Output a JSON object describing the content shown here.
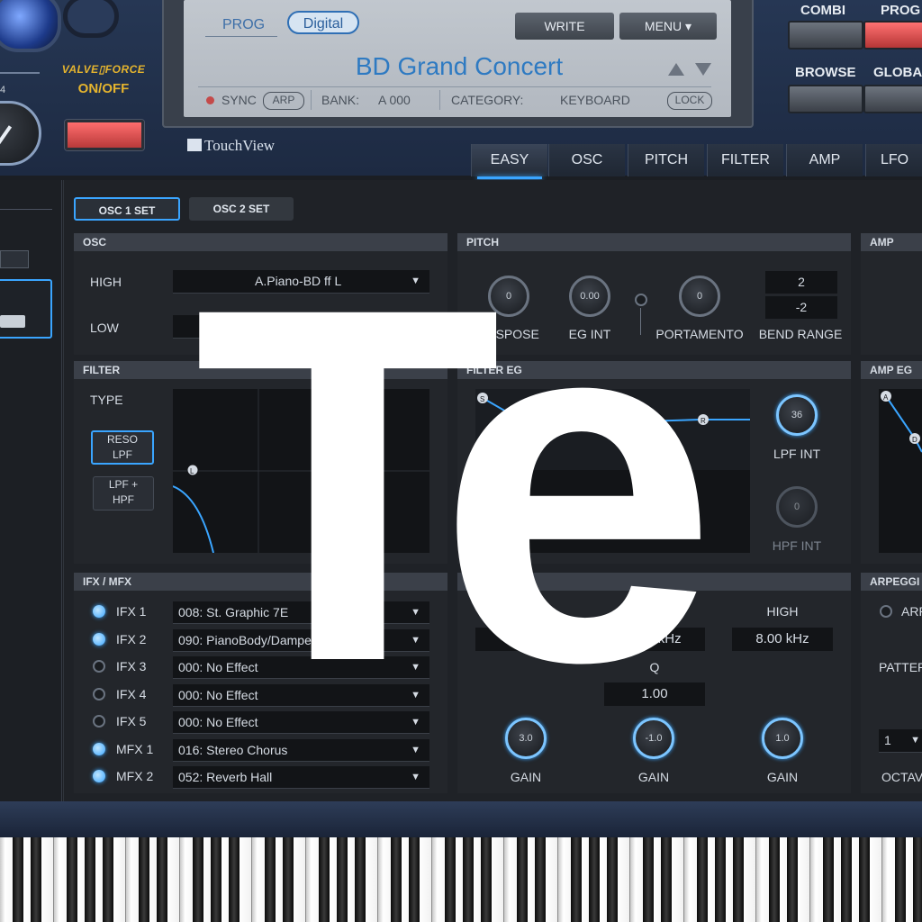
{
  "overlay_text": "Te",
  "left_panel": {
    "valve_force": "VALVE▯FORCE",
    "on_off": "ON/OFF",
    "knob_value": "4",
    "touchview": "TouchView"
  },
  "display": {
    "prog_label": "PROG",
    "mode_pill": "Digital",
    "write_button": "WRITE",
    "menu_button": "MENU ▾",
    "program_name": "BD Grand Concert",
    "sync_label": "SYNC",
    "arp_label": "ARP",
    "bank_label": "BANK:",
    "bank_value": "A 000",
    "category_label": "CATEGORY:",
    "category_value": "KEYBOARD",
    "lock_label": "LOCK"
  },
  "mode_buttons": {
    "combi": "COMBI",
    "prog": "PROG",
    "browse": "BROWSE",
    "global": "GLOBA"
  },
  "tabs": [
    "EASY",
    "OSC",
    "PITCH",
    "FILTER",
    "AMP",
    "LFO"
  ],
  "active_tab": "EASY",
  "osc_tabs": [
    "OSC 1 SET",
    "OSC 2 SET"
  ],
  "osc": {
    "header": "OSC",
    "high_label": "HIGH",
    "high_value": "A.Piano-BD ff L",
    "low_label": "LOW"
  },
  "pitch": {
    "header": "PITCH",
    "transpose_value": "0",
    "transpose_label": "ANSPOSE",
    "eg_int_value": "0.00",
    "eg_int_label": "EG INT",
    "portamento_value": "0",
    "portamento_label": "PORTAMENTO",
    "bend_up": "2",
    "bend_down": "-2",
    "bend_label": "BEND RANGE"
  },
  "amp": {
    "header": "AMP"
  },
  "filter": {
    "header": "FILTER",
    "type_label": "TYPE",
    "reso_lpf": "RESO\nLPF",
    "lpf_hpf": "LPF +\nHPF",
    "l_marker": "L"
  },
  "filter_eg": {
    "header": "FILTER EG",
    "s_marker": "S",
    "r_marker": "R",
    "lpf_int_value": "36",
    "lpf_int_label": "LPF INT",
    "hpf_int_value": "0",
    "hpf_int_label": "HPF INT"
  },
  "amp_eg": {
    "header": "AMP EG",
    "a_marker": "A",
    "d_marker": "D"
  },
  "fx": {
    "header": "IFX / MFX",
    "rows": [
      {
        "label": "IFX 1",
        "value": "008: St. Graphic 7E",
        "on": true
      },
      {
        "label": "IFX 2",
        "value": "090: PianoBody/Damper Simulation",
        "on": true
      },
      {
        "label": "IFX 3",
        "value": "000: No Effect",
        "on": false
      },
      {
        "label": "IFX 4",
        "value": "000: No Effect",
        "on": false
      },
      {
        "label": "IFX 5",
        "value": "000: No Effect",
        "on": false
      },
      {
        "label": "MFX 1",
        "value": "016: Stereo Chorus",
        "on": true
      },
      {
        "label": "MFX 2",
        "value": "052: Reverb Hall",
        "on": true
      }
    ]
  },
  "eq": {
    "header": "I",
    "high_label": "HIGH",
    "low_value": "80 Hz",
    "mid_value": "2.70 kHz",
    "high_value": "8.00 kHz",
    "q_label": "Q",
    "q_value": "1.00",
    "gain_low": "3.0",
    "gain_mid": "-1.0",
    "gain_high": "1.0",
    "gain_label": "GAIN"
  },
  "arpeggiator": {
    "header": "ARPEGGI",
    "arp_label": "ARP",
    "pattern_label": "PATTER",
    "octave_value": "1",
    "octave_label": "OCTAV"
  },
  "colors": {
    "accent": "#3aa5ff",
    "program_name": "#2e7ac2",
    "valve_force": "#e5b42e",
    "red_button": "#e05050"
  }
}
